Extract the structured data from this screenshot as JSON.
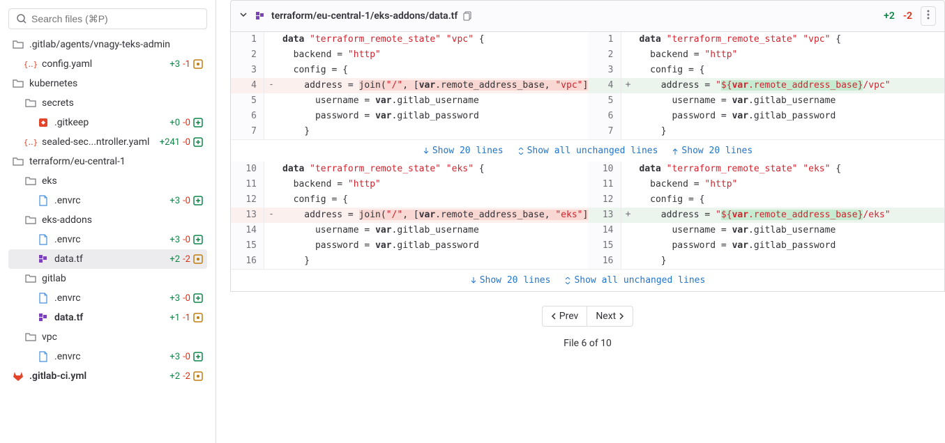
{
  "search": {
    "placeholder": "Search files (⌘P)"
  },
  "tree": [
    {
      "indent": 0,
      "icon": "folder",
      "label": ".gitlab/agents/vnagy-teks-admin",
      "type": "dir"
    },
    {
      "indent": 1,
      "icon": "yaml",
      "label": "config.yaml",
      "add": "+3",
      "rem": "-1",
      "badge": "mod"
    },
    {
      "indent": 0,
      "icon": "folder",
      "label": "kubernetes",
      "type": "dir"
    },
    {
      "indent": 1,
      "icon": "folder",
      "label": "secrets",
      "type": "dir"
    },
    {
      "indent": 2,
      "icon": "gitkeep",
      "label": ".gitkeep",
      "add": "+0",
      "rem": "-0",
      "badge": "add"
    },
    {
      "indent": 1,
      "icon": "yaml",
      "label": "sealed-sec...ntroller.yaml",
      "add": "+241",
      "rem": "-0",
      "badge": "add"
    },
    {
      "indent": 0,
      "icon": "folder",
      "label": "terraform/eu-central-1",
      "type": "dir"
    },
    {
      "indent": 1,
      "icon": "folder",
      "label": "eks",
      "type": "dir"
    },
    {
      "indent": 2,
      "icon": "file",
      "label": ".envrc",
      "add": "+3",
      "rem": "-0",
      "badge": "add"
    },
    {
      "indent": 1,
      "icon": "folder",
      "label": "eks-addons",
      "type": "dir"
    },
    {
      "indent": 2,
      "icon": "file",
      "label": ".envrc",
      "add": "+3",
      "rem": "-0",
      "badge": "add"
    },
    {
      "indent": 2,
      "icon": "tf",
      "label": "data.tf",
      "add": "+2",
      "rem": "-2",
      "badge": "mod",
      "active": true
    },
    {
      "indent": 1,
      "icon": "folder",
      "label": "gitlab",
      "type": "dir"
    },
    {
      "indent": 2,
      "icon": "file",
      "label": ".envrc",
      "add": "+3",
      "rem": "-0",
      "badge": "add"
    },
    {
      "indent": 2,
      "icon": "tf",
      "label": "data.tf",
      "add": "+1",
      "rem": "-1",
      "badge": "mod",
      "bold": true
    },
    {
      "indent": 1,
      "icon": "folder",
      "label": "vpc",
      "type": "dir"
    },
    {
      "indent": 2,
      "icon": "file",
      "label": ".envrc",
      "add": "+3",
      "rem": "-0",
      "badge": "add"
    },
    {
      "indent": 0,
      "icon": "gitlab",
      "label": ".gitlab-ci.yml",
      "add": "+2",
      "rem": "-2",
      "badge": "mod",
      "bold": true
    }
  ],
  "fileHeader": {
    "path": "terraform/eu-central-1/eks-addons/data.tf",
    "add": "+2",
    "rem": "-2"
  },
  "hunks": {
    "show20": "Show 20 lines",
    "showAll": "Show all unchanged lines"
  },
  "lines1": [
    {
      "oln": "1",
      "nln": "1",
      "os": " ",
      "ns": " ",
      "o": "<span class='tok-kw'>data</span> <span class='tok-str'>\"terraform_remote_state\" \"vpc\"</span> {",
      "n": "<span class='tok-kw'>data</span> <span class='tok-str'>\"terraform_remote_state\" \"vpc\"</span> {"
    },
    {
      "oln": "2",
      "nln": "2",
      "os": " ",
      "ns": " ",
      "o": "  backend = <span class='tok-str'>\"http\"</span>",
      "n": "  backend = <span class='tok-str'>\"http\"</span>"
    },
    {
      "oln": "3",
      "nln": "3",
      "os": " ",
      "ns": " ",
      "o": "  config = {",
      "n": "  config = {"
    },
    {
      "oln": "4",
      "nln": "4",
      "os": "-",
      "ns": "+",
      "rm": true,
      "ad": true,
      "o": "    address = <span class='hl-rm'>join(<span class='tok-str'>\"/\"</span>, [<span class='tok-var'>var</span>.remote_address_base, <span class='tok-str'>\"vpc\"</span>])</span>",
      "n": "    address = <span class='tok-str'>\"<span class='hl-ad'>${<span class='tok-var'>var</span>.remote_address_base}</span>/vpc\"</span>"
    },
    {
      "oln": "5",
      "nln": "5",
      "os": " ",
      "ns": " ",
      "o": "      username = <span class='tok-var'>var</span>.gitlab_username",
      "n": "      username = <span class='tok-var'>var</span>.gitlab_username"
    },
    {
      "oln": "6",
      "nln": "6",
      "os": " ",
      "ns": " ",
      "o": "      password = <span class='tok-var'>var</span>.gitlab_password",
      "n": "      password = <span class='tok-var'>var</span>.gitlab_password"
    },
    {
      "oln": "7",
      "nln": "7",
      "os": " ",
      "ns": " ",
      "o": "    }",
      "n": "    }"
    }
  ],
  "lines2": [
    {
      "oln": "10",
      "nln": "10",
      "os": " ",
      "ns": " ",
      "o": "<span class='tok-kw'>data</span> <span class='tok-str'>\"terraform_remote_state\" \"eks\"</span> {",
      "n": "<span class='tok-kw'>data</span> <span class='tok-str'>\"terraform_remote_state\" \"eks\"</span> {"
    },
    {
      "oln": "11",
      "nln": "11",
      "os": " ",
      "ns": " ",
      "o": "  backend = <span class='tok-str'>\"http\"</span>",
      "n": "  backend = <span class='tok-str'>\"http\"</span>"
    },
    {
      "oln": "12",
      "nln": "12",
      "os": " ",
      "ns": " ",
      "o": "  config = {",
      "n": "  config = {"
    },
    {
      "oln": "13",
      "nln": "13",
      "os": "-",
      "ns": "+",
      "rm": true,
      "ad": true,
      "o": "    address = <span class='hl-rm'>join(<span class='tok-str'>\"/\"</span>, [<span class='tok-var'>var</span>.remote_address_base, <span class='tok-str'>\"eks\"</span>])</span>",
      "n": "    address = <span class='tok-str'>\"<span class='hl-ad'>${<span class='tok-var'>var</span>.remote_address_base}</span>/eks\"</span>"
    },
    {
      "oln": "14",
      "nln": "14",
      "os": " ",
      "ns": " ",
      "o": "      username = <span class='tok-var'>var</span>.gitlab_username",
      "n": "      username = <span class='tok-var'>var</span>.gitlab_username"
    },
    {
      "oln": "15",
      "nln": "15",
      "os": " ",
      "ns": " ",
      "o": "      password = <span class='tok-var'>var</span>.gitlab_password",
      "n": "      password = <span class='tok-var'>var</span>.gitlab_password"
    },
    {
      "oln": "16",
      "nln": "16",
      "os": " ",
      "ns": " ",
      "o": "    }",
      "n": "    }"
    }
  ],
  "pager": {
    "prev": "Prev",
    "next": "Next"
  },
  "pageInfo": "File 6 of 10"
}
